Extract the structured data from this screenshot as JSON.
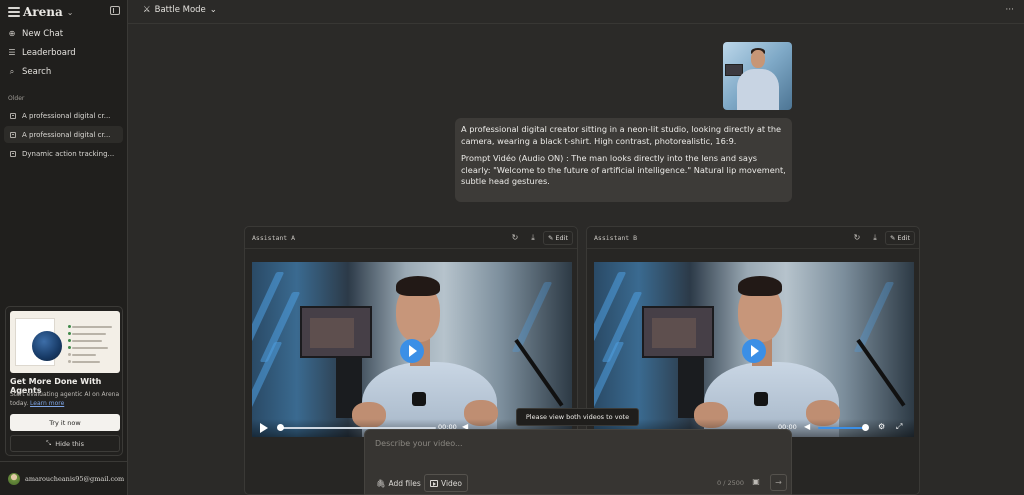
{
  "sidebar": {
    "brand": "Arena",
    "nav": [
      {
        "label": "New Chat",
        "icon": "new-chat-icon"
      },
      {
        "label": "Leaderboard",
        "icon": "leaderboard-icon"
      },
      {
        "label": "Search",
        "icon": "search-icon"
      }
    ],
    "older_label": "Older",
    "history": [
      {
        "label": "A professional digital cr..."
      },
      {
        "label": "A professional digital cr..."
      },
      {
        "label": "Dynamic action tracking..."
      }
    ],
    "promo": {
      "title": "Get More Done With Agents",
      "desc": "Start evaluating agentic AI on Arena today.",
      "link": "Learn more",
      "try_label": "Try it now",
      "hide_label": "Hide this"
    },
    "user_email": "amaroucheanis95@gmail.com"
  },
  "topbar": {
    "mode_label": "Battle Mode",
    "more_label": "···"
  },
  "message": {
    "paragraph1": "A professional digital creator sitting in a neon-lit studio, looking directly at the camera, wearing a black t-shirt. High contrast, photorealistic, 16:9.",
    "paragraph2": "Prompt Vidéo (Audio ON) : The man looks directly into the lens and says clearly: \"Welcome to the future of artificial intelligence.\" Natural lip movement, subtle head gestures."
  },
  "assistants": [
    {
      "name": "Assistant A",
      "edit_label": "Edit",
      "time": "00:00"
    },
    {
      "name": "Assistant B",
      "edit_label": "Edit",
      "time": "00:00"
    }
  ],
  "tooltip": "Please view both videos to vote",
  "composer": {
    "placeholder": "Describe your video...",
    "add_files_label": "Add files",
    "video_label": "Video",
    "char_count": "0 / 2500"
  },
  "colors": {
    "background": "#2b2a28",
    "sidebar": "#201f1d",
    "accent_play": "#3b8fe6",
    "link": "#7fa6e8"
  }
}
